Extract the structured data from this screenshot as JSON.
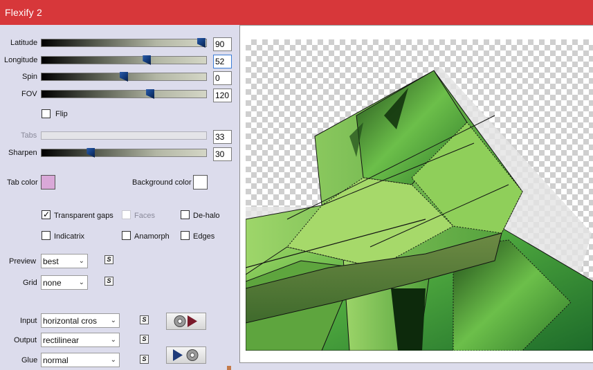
{
  "window": {
    "title": "Flexify 2"
  },
  "sliders": [
    {
      "label": "Latitude",
      "value": "90",
      "fraction": 0.97,
      "enabled": true
    },
    {
      "label": "Longitude",
      "value": "52",
      "fraction": 0.64,
      "enabled": true
    },
    {
      "label": "Spin",
      "value": "0",
      "fraction": 0.5,
      "enabled": true
    },
    {
      "label": "FOV",
      "value": "120",
      "fraction": 0.66,
      "enabled": true
    },
    {
      "label": "Tabs",
      "value": "33",
      "fraction": 0.0,
      "enabled": false
    },
    {
      "label": "Sharpen",
      "value": "30",
      "fraction": 0.3,
      "enabled": true
    }
  ],
  "flip": {
    "label": "Flip",
    "checked": false
  },
  "colors": {
    "tab_label": "Tab color",
    "tab_color": "#d9a8d8",
    "background_label": "Background color",
    "background_color": "#ffffff"
  },
  "options": {
    "transparent_gaps": {
      "label": "Transparent gaps",
      "checked": true
    },
    "faces": {
      "label": "Faces",
      "checked": false,
      "enabled": false
    },
    "de_halo": {
      "label": "De-halo",
      "checked": false
    },
    "indicatrix": {
      "label": "Indicatrix",
      "checked": false
    },
    "anamorph": {
      "label": "Anamorph",
      "checked": false
    },
    "edges": {
      "label": "Edges",
      "checked": false
    }
  },
  "preview": {
    "label": "Preview",
    "value": "best"
  },
  "grid": {
    "label": "Grid",
    "value": "none"
  },
  "input": {
    "label": "Input",
    "value": "horizontal cros"
  },
  "output": {
    "label": "Output",
    "value": "rectilinear"
  },
  "glue": {
    "label": "Glue",
    "value": "normal"
  },
  "icons": {
    "swap": "swap-icon",
    "play_forward": "globe-to-arrow-icon",
    "play_back": "arrow-to-globe-icon"
  }
}
